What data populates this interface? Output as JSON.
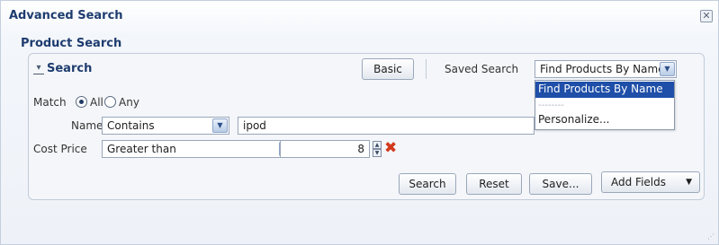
{
  "dialog": {
    "title": "Advanced Search",
    "close_icon": "close-icon"
  },
  "section": {
    "title": "Product Search"
  },
  "panel": {
    "title": "Search",
    "collapse_icon": "chevron-down-icon",
    "basic_label": "Basic",
    "saved_search_label": "Saved Search",
    "saved_search_value": "Find Products By Name"
  },
  "saved_search_menu": {
    "items": [
      "Find Products By Name",
      "--------",
      "Personalize..."
    ],
    "selected_index": 0
  },
  "match": {
    "label": "Match",
    "options": [
      "All",
      "Any"
    ],
    "selected": "All"
  },
  "criteria": [
    {
      "label": "Name",
      "operator": "Contains",
      "value": "ipod"
    },
    {
      "label": "Cost Price",
      "operator": "Greater than",
      "value": "8"
    }
  ],
  "actions": {
    "search": "Search",
    "reset": "Reset",
    "save": "Save...",
    "add_fields": "Add Fields"
  },
  "colors": {
    "title": "#1e3c6e",
    "menu_selected": "#1f4fa8",
    "remove_icon": "#d23a1c"
  }
}
